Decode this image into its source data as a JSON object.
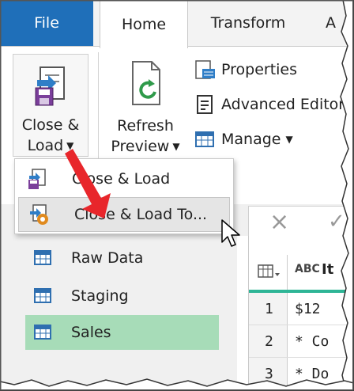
{
  "tabs": {
    "file": "File",
    "home": "Home",
    "transform": "Transform",
    "partial": "A"
  },
  "ribbon": {
    "close_load": {
      "line1": "Close &",
      "line2": "Load"
    },
    "refresh_preview": {
      "line1": "Refresh",
      "line2": "Preview"
    },
    "properties": "Properties",
    "advanced_editor": "Advanced Editor",
    "manage": "Manage"
  },
  "dropdown": {
    "item1": "Close & Load",
    "item2": "Close & Load To..."
  },
  "formula_bar": {
    "cancel": "×",
    "confirm": "✓"
  },
  "queries": [
    {
      "label": "Raw Data"
    },
    {
      "label": "Staging"
    },
    {
      "label": "Sales"
    }
  ],
  "grid": {
    "header_type": "ABC",
    "header_partial": "It",
    "rows": [
      {
        "num": "1",
        "value": "$12"
      },
      {
        "num": "2",
        "value": "* Co"
      },
      {
        "num": "3",
        "value": "* Do"
      }
    ]
  },
  "colors": {
    "file_tab": "#1f6fb9",
    "selected_query": "#a7dcb8",
    "arrow": "#e8262b",
    "grid_accent": "#2eb596"
  }
}
